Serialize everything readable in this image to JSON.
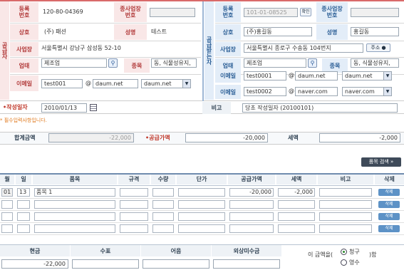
{
  "supplier": {
    "side_title": "공급자",
    "reg_no_label": "등록\n번호",
    "reg_no": "120-80-04369",
    "sub_biz_label": "종사업장\n번호",
    "name_label": "상호",
    "name": "(주) 패션",
    "rep_label": "성명",
    "rep": "테스트",
    "addr_label": "사업장",
    "addr": "서울특별시 강남구 삼성동 52-10",
    "biz_type_label": "업태",
    "biz_type": "제조업",
    "biz_item_label": "종목",
    "biz_item": "동, 식물성유지,",
    "email_label": "이메일",
    "email_id": "test001",
    "email_domain": "daum.net",
    "email_select": "daum.net"
  },
  "receiver": {
    "side_title": "공급받는자",
    "reg_no_label": "등록\n번호",
    "reg_no": "101-01-08525",
    "confirm_label": "확인",
    "sub_biz_label": "종사업장\n번호",
    "name_label": "상호",
    "name": "(주)홍길동",
    "rep_label": "성명",
    "rep": "홍길동",
    "addr_label": "사업장",
    "addr": "서울특별시 종로구 수송동 104번지",
    "addr_btn": "주소",
    "biz_type_label": "업태",
    "biz_type": "제조업",
    "biz_item_label": "종목",
    "biz_item": "동, 식물성유지,",
    "email_label": "이메일",
    "email1_id": "test0001",
    "email1_domain": "daum.net",
    "email1_select": "daum.net",
    "email2_id": "test0002",
    "email2_domain": "naver.com",
    "email2_select": "naver.com"
  },
  "at": "@",
  "date_label": "작성일자",
  "date_value": "2010/01/13",
  "remark_label": "비고",
  "remark_value": "당초 작성일자 (20100101)",
  "required_note": "* 필수입력사항입니다.",
  "totals": {
    "total_label": "합계금액",
    "total_value": "-22,000",
    "supply_label": "공급가액",
    "supply_value": "-20,000",
    "tax_label": "세액",
    "tax_value": "-2,000"
  },
  "item_search_btn": "품목 검색 »",
  "table": {
    "headers": [
      "월",
      "일",
      "품목",
      "규격",
      "수량",
      "단가",
      "공급가액",
      "세액",
      "비고",
      "삭제"
    ],
    "rows": [
      {
        "month": "01",
        "day": "13",
        "item": "품목 1",
        "spec": "",
        "qty": "",
        "price": "",
        "supply": "-20,000",
        "tax": "-2,000",
        "note": ""
      },
      {
        "month": "",
        "day": "",
        "item": "",
        "spec": "",
        "qty": "",
        "price": "",
        "supply": "",
        "tax": "",
        "note": ""
      },
      {
        "month": "",
        "day": "",
        "item": "",
        "spec": "",
        "qty": "",
        "price": "",
        "supply": "",
        "tax": "",
        "note": ""
      },
      {
        "month": "",
        "day": "",
        "item": "",
        "spec": "",
        "qty": "",
        "price": "",
        "supply": "",
        "tax": "",
        "note": ""
      }
    ],
    "delete_label": "삭제"
  },
  "payment": {
    "headers": [
      "현금",
      "수표",
      "어음",
      "외상미수금"
    ],
    "cash_value": "-22,000",
    "receipt_label": "이 금액을(",
    "receipt_suffix": ")함",
    "opt_claim": "청구",
    "opt_receipt": "영수",
    "selected": "청구"
  }
}
